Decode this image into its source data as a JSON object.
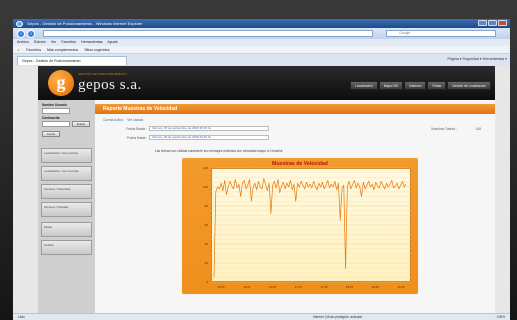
{
  "window": {
    "title": "Gepos - Gestión de Posicionamiento - Windows Internet Explorer"
  },
  "addressbar": {
    "url": "",
    "search_placeholder": "Google"
  },
  "menu": [
    "Archivo",
    "Edición",
    "Ver",
    "Favoritos",
    "Herramientas",
    "Ayuda"
  ],
  "favorites_bar": {
    "favorites_label": "Favoritos",
    "items": [
      "Más complementos",
      "Sitios sugeridos"
    ]
  },
  "tab": {
    "label": "Gepos - Gestión de Posicionamiento"
  },
  "ie_tools": "Página ▾  Seguridad ▾  Herramientas ▾",
  "site": {
    "logo_letter": "g",
    "brand": "gepos s.a.",
    "brand_tag": "GESTIÓN DE POSICIONAMIENTO",
    "nav": [
      "Localización",
      "Mapa GIS",
      "Informes",
      "Flotas",
      "Gestión de Localización"
    ]
  },
  "sidebar": {
    "user_label": "Nombre Usuario",
    "password_label": "Contraseña",
    "buttons": [
      "Entrar",
      "Cerrar"
    ],
    "links": [
      "Localización / Ver posición",
      "Localización / Ver recorrido",
      "Informes / Velocidad",
      "Informes / Paradas",
      "Flotas",
      "Gestión"
    ]
  },
  "main": {
    "title": "Reporte Muestras de Velocidad",
    "breadcrumb": [
      "Cuenta Activa :",
      "Ver Listado"
    ],
    "from_label": "Fecha Desde :",
    "from_value": "Viernes, 05 de septiembre de 2008 15:45 hs",
    "to_label": "Fecha Hasta :",
    "to_value": "Viernes, 05 de septiembre de 2008 20:45 hs",
    "samples_label": "Muestras Totales :",
    "samples_value": "168",
    "note": "Las fechas son válidas solamente los mensajes recibidos con velocidad mayor a 0 kms/hs"
  },
  "chart_data": {
    "type": "line",
    "title": "Muestras de Velocidad",
    "xlabel": "",
    "ylabel": "",
    "ylim": [
      0,
      120
    ],
    "grid": true,
    "yticks": [
      "0",
      "20",
      "40",
      "60",
      "80",
      "100",
      "120"
    ],
    "xticks": [
      "15:45",
      "16:15",
      "16:45",
      "17:15",
      "17:45",
      "18:15",
      "18:45",
      "19:15"
    ],
    "series": [
      {
        "values": [
          5,
          95,
          100,
          98,
          104,
          96,
          107,
          92,
          100,
          106,
          101,
          98,
          108,
          99,
          103,
          90,
          104,
          107,
          98,
          102,
          108,
          85,
          100,
          104,
          97,
          106,
          100,
          98,
          109,
          103,
          96,
          104,
          72,
          102,
          106,
          99,
          108,
          94,
          101,
          105,
          98,
          104,
          100,
          107,
          97,
          103,
          85,
          104,
          100,
          106,
          102,
          98,
          105,
          100,
          103,
          99,
          106,
          101,
          97,
          104,
          100,
          105,
          98,
          102,
          107,
          99,
          103,
          100,
          106,
          97,
          104,
          65,
          98,
          102,
          14,
          100,
          106,
          98,
          103,
          107,
          99,
          104,
          100,
          90,
          105,
          98,
          102,
          106,
          100,
          103,
          97,
          105,
          101,
          99,
          106,
          102,
          98,
          104,
          100,
          103,
          107,
          99,
          101,
          104,
          98,
          102,
          106,
          100,
          103
        ]
      }
    ]
  },
  "status": {
    "done": "Listo",
    "zone": "Internet | Modo protegido: activado",
    "zoom": "100%"
  },
  "colors": {
    "accent": "#ef8f1c",
    "series": "#e8760e",
    "chart_title": "#b3170a"
  }
}
